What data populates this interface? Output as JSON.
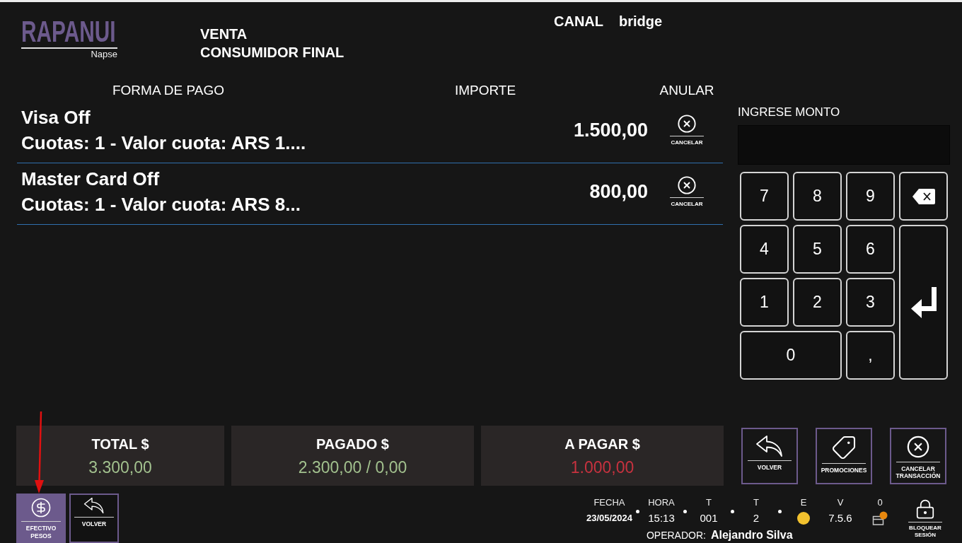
{
  "header": {
    "logo": {
      "brand": "RAPANUI",
      "tagline": "Napse"
    },
    "title_lines": [
      "VENTA",
      "CONSUMIDOR FINAL"
    ],
    "channel": {
      "label": "CANAL",
      "value": "bridge"
    }
  },
  "payments": {
    "columns": [
      "FORMA DE PAGO",
      "IMPORTE",
      "ANULAR"
    ],
    "rows": [
      {
        "method": "Visa Off",
        "detail": "Cuotas: 1 - Valor cuota: ARS 1....",
        "amount": "1.500,00",
        "cancel_label": "CANCELAR"
      },
      {
        "method": "Master Card Off",
        "detail": "Cuotas: 1 - Valor cuota: ARS 8...",
        "amount": "800,00",
        "cancel_label": "CANCELAR"
      }
    ]
  },
  "amount_entry": {
    "label": "INGRESE MONTO",
    "keys": [
      {
        "kind": "key",
        "label": "7"
      },
      {
        "kind": "key",
        "label": "8"
      },
      {
        "kind": "key",
        "label": "9"
      },
      {
        "kind": "backspace"
      },
      {
        "kind": "key",
        "label": "4"
      },
      {
        "kind": "key",
        "label": "5"
      },
      {
        "kind": "key",
        "label": "6"
      },
      {
        "kind": "enter"
      },
      {
        "kind": "key",
        "label": "1"
      },
      {
        "kind": "key",
        "label": "2"
      },
      {
        "kind": "key",
        "label": "3"
      },
      {
        "kind": "wide_key",
        "label": "0"
      },
      {
        "kind": "key",
        "label": ","
      }
    ]
  },
  "totals": [
    {
      "label": "TOTAL $",
      "value": "3.300,00",
      "color": "#a2c18e"
    },
    {
      "label": "PAGADO $",
      "value": "2.300,00 / 0,00",
      "color": "#a2c18e"
    },
    {
      "label": "A PAGAR $",
      "value": "1.000,00",
      "color": "#c8323f"
    }
  ],
  "actions": [
    {
      "kind": "back",
      "label": "VOLVER"
    },
    {
      "kind": "promotions",
      "label": "PROMOCIONES"
    },
    {
      "kind": "cancel",
      "label": "CANCELAR TRANSACCIÓN"
    }
  ],
  "bottom_buttons": [
    {
      "kind": "cash",
      "label": "EFECTIVO PESOS",
      "selected": true
    },
    {
      "kind": "back",
      "label": "VOLVER",
      "selected": false
    }
  ],
  "status": {
    "items": [
      {
        "label": "FECHA",
        "value": "23/05/2024",
        "kind": "date",
        "dot_after": true
      },
      {
        "label": "HORA",
        "value": "15:13",
        "kind": "text",
        "dot_after": true
      },
      {
        "label": "T",
        "value": "001",
        "kind": "text",
        "dot_after": true
      },
      {
        "label": "T",
        "value": "2",
        "kind": "text",
        "dot_after": true
      },
      {
        "label": "E",
        "kind": "light",
        "color": "#f2c12e",
        "dot_after": false
      },
      {
        "label": "V",
        "value": "7.5.6",
        "kind": "text",
        "dot_after": false
      },
      {
        "label": "0",
        "kind": "box_icon",
        "dot_after": false
      }
    ],
    "operator": {
      "label": "OPERADOR:",
      "name": "Alejandro Silva"
    }
  },
  "lock_button": {
    "label": "BLOQUEAR SESIÓN"
  }
}
